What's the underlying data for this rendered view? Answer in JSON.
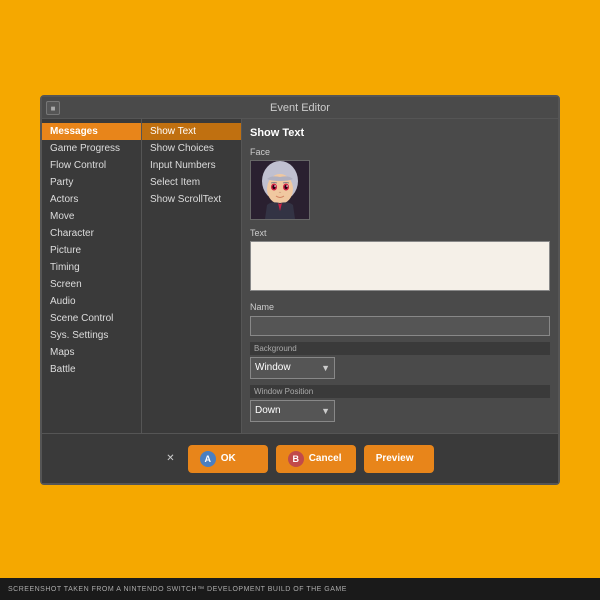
{
  "window": {
    "title": "Event Editor"
  },
  "sidebar": {
    "items": [
      {
        "label": "Messages",
        "active": true
      },
      {
        "label": "Game Progress",
        "active": false
      },
      {
        "label": "Flow Control",
        "active": false
      },
      {
        "label": "Party",
        "active": false
      },
      {
        "label": "Actors",
        "active": false
      },
      {
        "label": "Move",
        "active": false
      },
      {
        "label": "Character",
        "active": false
      },
      {
        "label": "Picture",
        "active": false
      },
      {
        "label": "Timing",
        "active": false
      },
      {
        "label": "Screen",
        "active": false
      },
      {
        "label": "Audio",
        "active": false
      },
      {
        "label": "Scene Control",
        "active": false
      },
      {
        "label": "Sys. Settings",
        "active": false
      },
      {
        "label": "Maps",
        "active": false
      },
      {
        "label": "Battle",
        "active": false
      }
    ]
  },
  "middle_panel": {
    "items": [
      {
        "label": "Show Text",
        "active": true
      },
      {
        "label": "Show Choices",
        "active": false
      },
      {
        "label": "Input Numbers",
        "active": false
      },
      {
        "label": "Select Item",
        "active": false
      },
      {
        "label": "Show ScrollText",
        "active": false
      }
    ]
  },
  "right_panel": {
    "title": "Show Text",
    "face_label": "Face",
    "text_label": "Text",
    "name_label": "Name",
    "background_label": "Background",
    "background_value": "Window",
    "window_position_label": "Window Position",
    "window_position_value": "Down"
  },
  "actions": {
    "ok_label": "OK",
    "cancel_label": "Cancel",
    "preview_label": "Preview",
    "ok_circle": "A",
    "cancel_circle": "B"
  },
  "bottom_bar": {
    "text": "SCREENSHOT TAKEN FROM A NINTENDO SWITCH™ DEVELOPMENT BUILD OF THE GAME"
  }
}
